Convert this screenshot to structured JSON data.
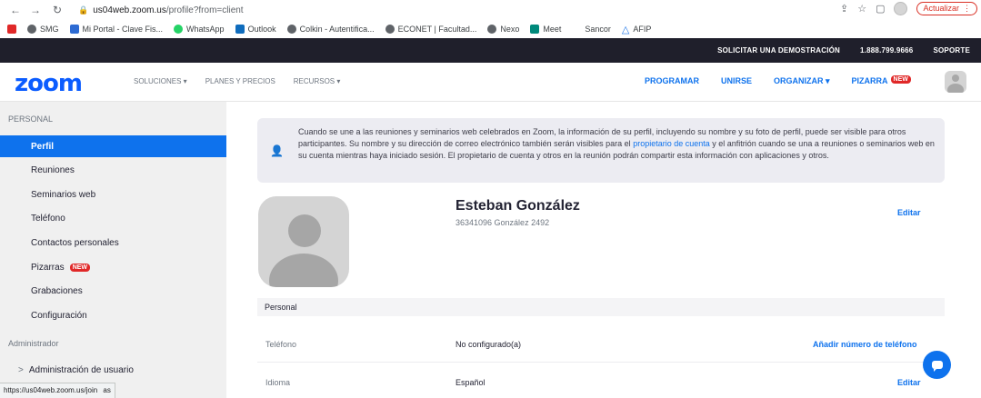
{
  "browser": {
    "url_host": "us04web.zoom.us",
    "url_path": "/profile?from=client",
    "update_label": "Actualizar",
    "status_url": "https://us04web.zoom.us/join",
    "status_tail": "as"
  },
  "bookmarks": [
    {
      "label": "",
      "color": "#e02828"
    },
    {
      "label": "SMG",
      "color": "#5f6368"
    },
    {
      "label": "Mi Portal - Clave Fis...",
      "color": "#2d6bd3"
    },
    {
      "label": "WhatsApp",
      "color": "#25d366"
    },
    {
      "label": "Outlook",
      "color": "#0f6cbd"
    },
    {
      "label": "Colkin - Autentifica...",
      "color": "#5f6368"
    },
    {
      "label": "ECONET | Facultad...",
      "color": "#5f6368"
    },
    {
      "label": "Nexo",
      "color": "#5f6368"
    },
    {
      "label": "Meet",
      "color": "#00897b"
    },
    {
      "label": "Sancor",
      "color": "#ffffff"
    },
    {
      "label": "AFIP",
      "color": "#1a73e8"
    }
  ],
  "topbar": {
    "demo": "SOLICITAR UNA DEMOSTRACIÓN",
    "phone": "1.888.799.9666",
    "support": "SOPORTE"
  },
  "header": {
    "logo": "zoom",
    "menu_left": [
      "SOLUCIONES ▾",
      "PLANES Y PRECIOS",
      "RECURSOS ▾"
    ],
    "programar": "PROGRAMAR",
    "unirse": "UNIRSE",
    "organizar": "ORGANIZAR ▾",
    "pizarra": "PIZARRA",
    "new_badge": "NEW"
  },
  "sidebar": {
    "section_personal": "PERSONAL",
    "items": [
      {
        "label": "Perfil",
        "active": true
      },
      {
        "label": "Reuniones"
      },
      {
        "label": "Seminarios web"
      },
      {
        "label": "Teléfono"
      },
      {
        "label": "Contactos personales"
      },
      {
        "label": "Pizarras"
      },
      {
        "label": "Grabaciones"
      },
      {
        "label": "Configuración"
      }
    ],
    "pizarras_badge": "NEW",
    "section_admin": "Administrador",
    "admin_item": "Administración de usuario",
    "admin_chevron": ">"
  },
  "info": {
    "text_1": "Cuando se une a las reuniones y seminarios web celebrados en Zoom, la información de su perfil, incluyendo su nombre y su foto de perfil, puede ser visible para otros participantes. Su nombre y su dirección de correo electrónico también serán visibles para el ",
    "link": "propietario de cuenta",
    "text_2": " y el anfitrión cuando se una a reuniones o seminarios web en su cuenta mientras haya iniciado sesión. El propietario de cuenta y otros en la reunión podrán compartir esta información con aplicaciones y otros."
  },
  "profile": {
    "name": "Esteban González",
    "subtitle": "36341096 González 2492",
    "edit": "Editar"
  },
  "section": {
    "title": "Personal"
  },
  "rows": [
    {
      "label": "Teléfono",
      "value": "No configurado(a)",
      "action": "Añadir número de teléfono"
    },
    {
      "label": "Idioma",
      "value": "Español",
      "action": "Editar"
    }
  ]
}
